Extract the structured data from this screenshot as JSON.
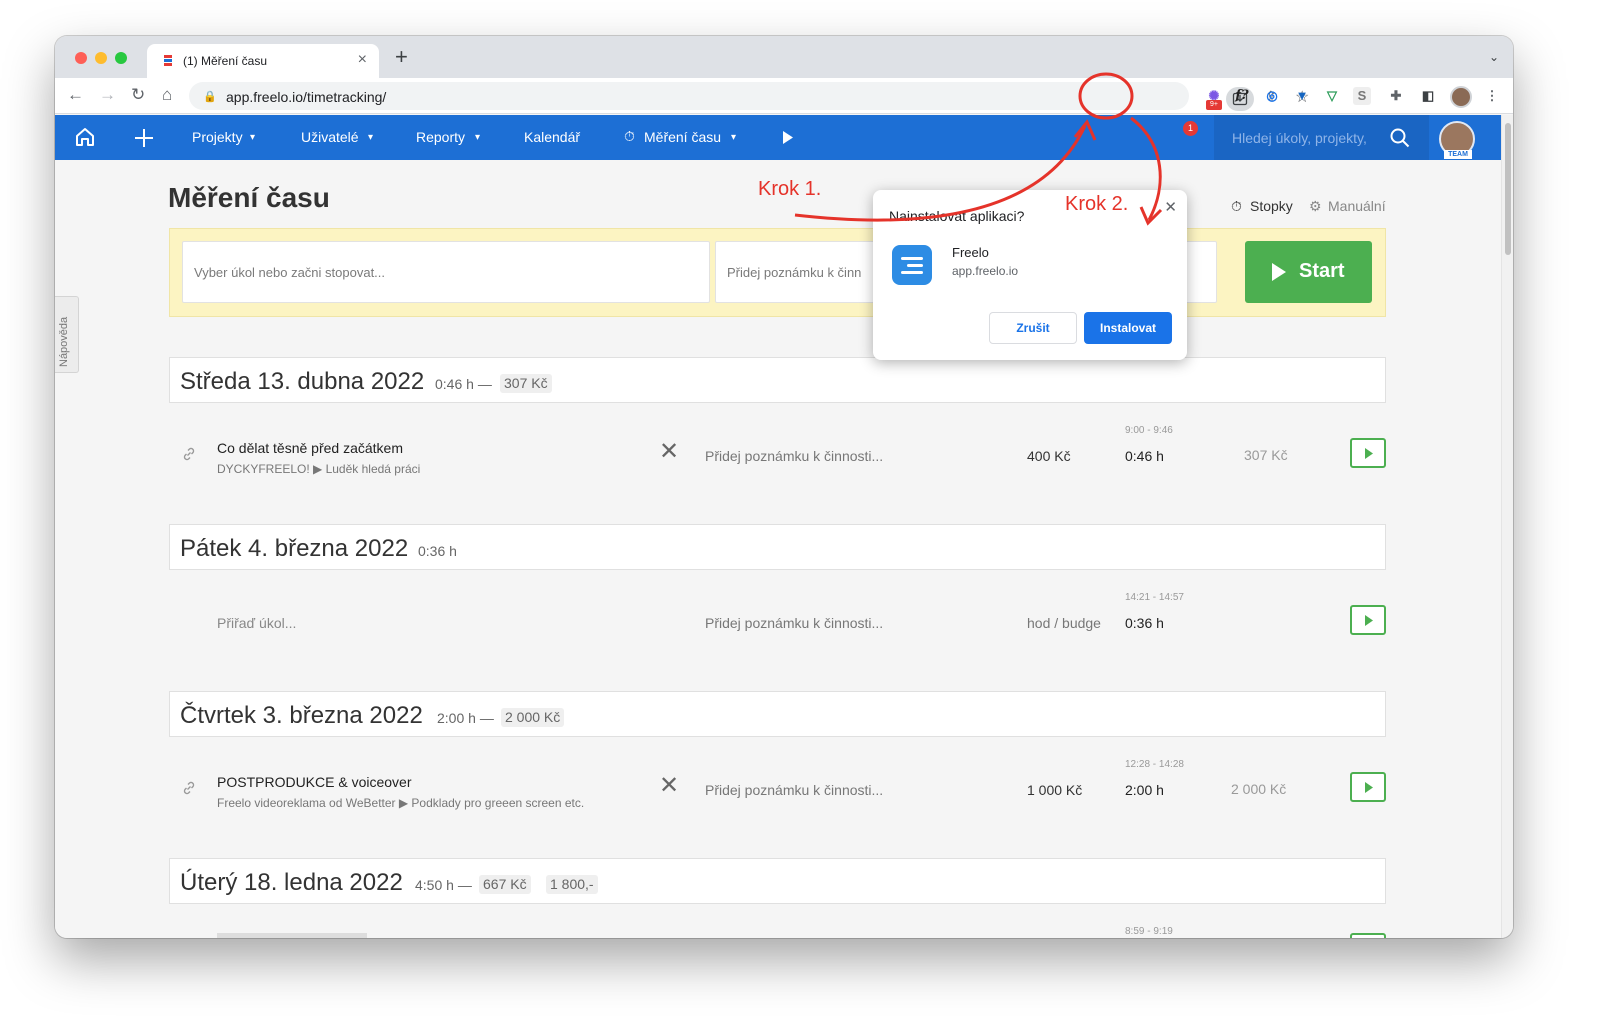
{
  "browser": {
    "tab_title": "(1) Měření času",
    "url": "app.freelo.io/timetracking/",
    "extension_badge": "9+"
  },
  "nav": {
    "projects": "Projekty",
    "users": "Uživatelé",
    "reports": "Reporty",
    "calendar": "Kalendář",
    "time": "Měření času",
    "notification_count": "1",
    "search_placeholder": "Hledej úkoly, projekty,",
    "team_label": "TEAM"
  },
  "help_label": "Nápověda",
  "page_title": "Měření času",
  "modes": {
    "stopwatch": "Stopky",
    "manual": "Manuální"
  },
  "tracker": {
    "task_placeholder": "Vyber úkol nebo začni stopovat...",
    "note_placeholder": "Přidej poznámku k činn",
    "start_label": "Start"
  },
  "days": [
    {
      "title": "Středa 13. dubna 2022",
      "summary": "0:46 h —",
      "pills": [
        "307 Kč"
      ],
      "entry": {
        "task": "Co dělat těsně před začátkem",
        "project": "DYCKYFREELO! ▶ Luděk hledá práci",
        "note": "Přidej poznámku k činnosti...",
        "rate": "400 Kč",
        "time_range": "9:00 - 9:46",
        "duration": "0:46 h",
        "cost": "307 Kč"
      }
    },
    {
      "title": "Pátek 4. března 2022",
      "summary": "0:36 h",
      "pills": [],
      "entry": {
        "task_placeholder": "Přiřaď úkol...",
        "note": "Přidej poznámku k činnosti...",
        "rate": "hod / budge",
        "time_range": "14:21 - 14:57",
        "duration": "0:36 h"
      }
    },
    {
      "title": "Čtvrtek 3. března 2022",
      "summary": "2:00 h —",
      "pills": [
        "2 000 Kč"
      ],
      "entry": {
        "task": "POSTPRODUKCE & voiceover",
        "project": "Freelo videoreklama od WeBetter ▶ Podklady pro greeen screen etc.",
        "note": "Přidej poznámku k činnosti...",
        "rate": "1 000 Kč",
        "time_range": "12:28 - 14:28",
        "duration": "2:00 h",
        "cost": "2 000 Kč"
      }
    },
    {
      "title": "Úterý 18. ledna 2022",
      "summary": "4:50 h —",
      "pills": [
        "667 Kč",
        "1 800,-"
      ],
      "entry": {
        "time_range": "8:59 - 9:19"
      }
    }
  ],
  "install_popup": {
    "title": "Nainstalovat aplikaci?",
    "app_name": "Freelo",
    "app_url": "app.freelo.io",
    "cancel_label": "Zrušit",
    "install_label": "Instalovat"
  },
  "annotations": {
    "step1": "Krok 1.",
    "step2": "Krok 2.",
    "color": "#e5332a"
  },
  "colors": {
    "brand_blue": "#1d6fd5",
    "start_green": "#4caf50",
    "tracker_bg": "#fcf4c2"
  }
}
